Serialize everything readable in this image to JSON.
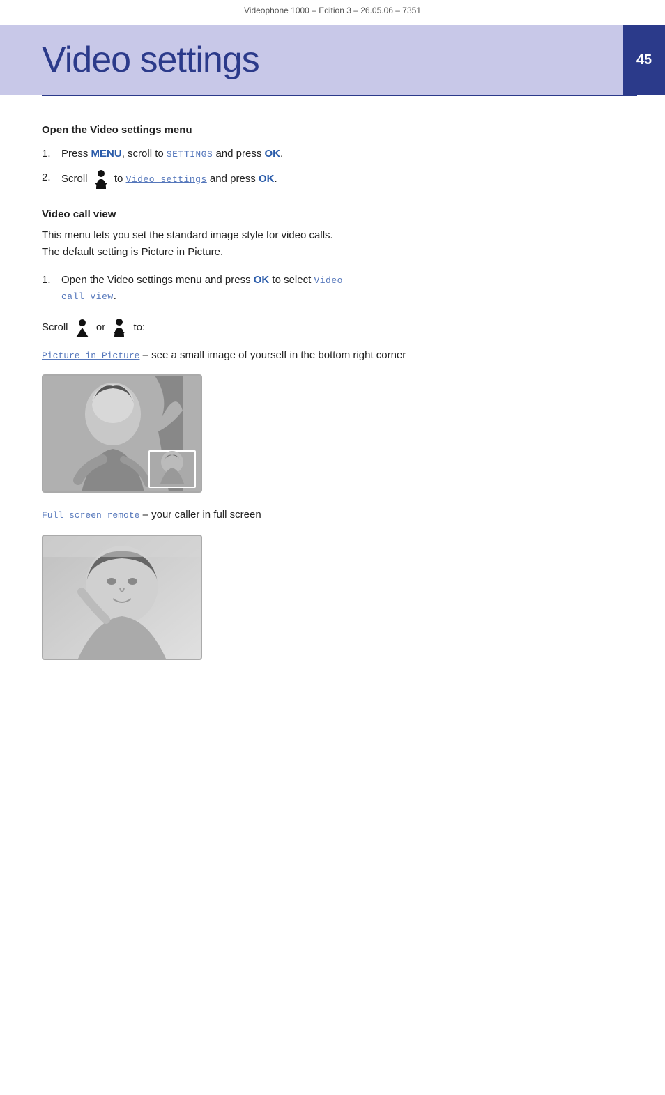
{
  "header": {
    "title": "Videophone 1000 – Edition 3 – 26.05.06 – 7351"
  },
  "page": {
    "title": "Video settings",
    "number": "45"
  },
  "sections": {
    "open_menu": {
      "heading": "Open the Video settings menu",
      "steps": [
        {
          "num": "1.",
          "parts": [
            {
              "text": "Press ",
              "type": "normal"
            },
            {
              "text": "MENU",
              "type": "bold-blue"
            },
            {
              "text": ", scroll to ",
              "type": "normal"
            },
            {
              "text": "SETTINGS",
              "type": "mono-blue"
            },
            {
              "text": " and press ",
              "type": "normal"
            },
            {
              "text": "OK",
              "type": "bold-blue"
            },
            {
              "text": ".",
              "type": "normal"
            }
          ]
        },
        {
          "num": "2.",
          "parts": [
            {
              "text": "Scroll ",
              "type": "normal"
            },
            {
              "text": "ICON_DOWN",
              "type": "icon"
            },
            {
              "text": " to ",
              "type": "normal"
            },
            {
              "text": "Video settings",
              "type": "mono-blue"
            },
            {
              "text": " and press ",
              "type": "normal"
            },
            {
              "text": "OK",
              "type": "bold-blue"
            },
            {
              "text": ".",
              "type": "normal"
            }
          ]
        }
      ]
    },
    "video_call_view": {
      "heading": "Video call view",
      "description": "This menu lets you set the standard image style for video calls.\nThe default setting is Picture in Picture.",
      "step1_pre": "Open the Video settings menu and press ",
      "step1_ok": "OK",
      "step1_post": " to select ",
      "step1_link": "Video call view",
      "scroll_label": "Scroll",
      "scroll_or": "or",
      "scroll_to": "to:",
      "pip_label": "Picture in Picture",
      "pip_desc": "– see a small image of yourself in the bottom right corner",
      "fsr_label": "Full screen remote",
      "fsr_desc": "– your caller in full screen"
    }
  }
}
